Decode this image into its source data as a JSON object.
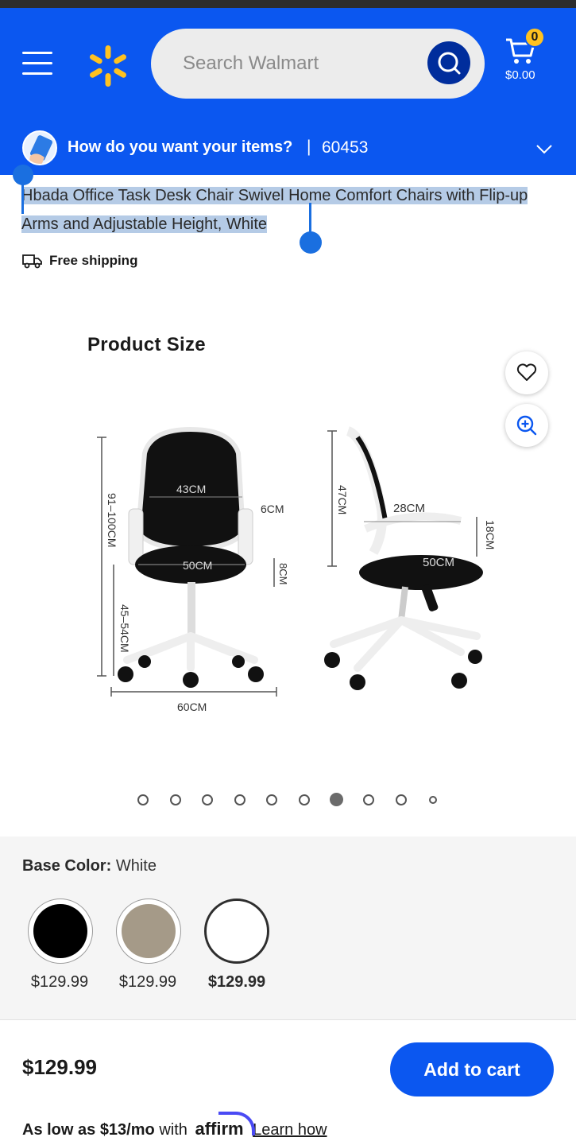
{
  "header": {
    "menu_icon": "hamburger-menu-icon",
    "logo_icon": "walmart-spark-icon",
    "search": {
      "placeholder": "Search Walmart"
    },
    "search_icon": "search-icon",
    "cart": {
      "count": "0",
      "total": "$0.00",
      "icon": "cart-icon"
    },
    "brand_color": "#0b57f0",
    "spark_color": "#ffc220"
  },
  "delivery": {
    "question": "How do you want your items?",
    "separator": "|",
    "zip": "60453",
    "chevron_icon": "chevron-down-icon"
  },
  "product": {
    "title_selected": "Hbada Office Task Desk Chair Swivel Home Comfort Chairs with Flip-up Arms and Adjustable Height, White",
    "shipping": {
      "icon": "truck-icon",
      "label": "Free shipping"
    }
  },
  "image": {
    "heading": "Product Size",
    "favorite_icon": "heart-icon",
    "zoom_icon": "zoom-in-icon",
    "dimensions": {
      "height_total": "91–100CM",
      "seat_height": "45–54CM",
      "back_width": "43CM",
      "arm": "6CM",
      "arm_height": "8CM",
      "seat_width": "50CM",
      "base": "60CM",
      "back_height": "47CM",
      "depth": "28CM",
      "seat_depth": "50CM",
      "arm_side": "18CM"
    },
    "carousel": {
      "total": 10,
      "active_index": 6
    }
  },
  "variants": {
    "label": "Base Color:",
    "selected": "White",
    "options": [
      {
        "color": "#000000",
        "price": "$129.99"
      },
      {
        "color": "#a59a88",
        "price": "$129.99"
      },
      {
        "color": "#ffffff",
        "price": "$129.99"
      }
    ]
  },
  "footer": {
    "price": "$129.99",
    "add_to_cart": "Add to cart",
    "affirm_prefix": "As low as $13/mo",
    "affirm_with": "with",
    "affirm_brand": "affirm",
    "learn_how": "Learn how"
  }
}
